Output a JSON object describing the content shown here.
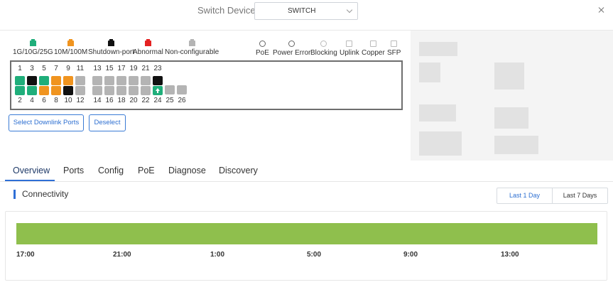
{
  "header": {
    "label": "Switch Device",
    "device_value": "SWITCH"
  },
  "legend": [
    {
      "label": "1G/10G/25G",
      "color": "#1fae7a"
    },
    {
      "label": "10M/100M",
      "color": "#f0941f"
    },
    {
      "label": "Shutdown-port",
      "color": "#111111"
    },
    {
      "label": "Abnormal",
      "color": "#e42222"
    },
    {
      "label": "Non-configurable",
      "color": "#b4b4b4"
    }
  ],
  "status_legend": [
    {
      "label": "PoE",
      "icon": "poe-icon"
    },
    {
      "label": "Power Error",
      "icon": "power-error-icon"
    },
    {
      "label": "Blocking",
      "icon": "blocking-icon"
    },
    {
      "label": "Uplink",
      "icon": "uplink-icon"
    },
    {
      "label": "Copper",
      "icon": "copper-icon"
    },
    {
      "label": "SFP",
      "icon": "sfp-icon"
    }
  ],
  "ports": {
    "top_numbers": [
      "1",
      "3",
      "5",
      "7",
      "9",
      "11",
      "13",
      "15",
      "17",
      "19",
      "21",
      "23"
    ],
    "bottom_numbers": [
      "2",
      "4",
      "6",
      "8",
      "10",
      "12",
      "14",
      "16",
      "18",
      "20",
      "22",
      "24",
      "25",
      "26"
    ],
    "top_status": [
      "green",
      "black",
      "green",
      "orange",
      "orange",
      "gray",
      "gray",
      "gray",
      "gray",
      "gray",
      "gray",
      "black"
    ],
    "bottom_status": [
      "green",
      "green",
      "orange",
      "orange",
      "black",
      "gray",
      "gray",
      "gray",
      "gray",
      "gray",
      "gray",
      "green-uplink",
      "gray",
      "gray"
    ]
  },
  "actions": {
    "select_downlink": "Select Downlink Ports",
    "deselect": "Deselect"
  },
  "tabs": [
    "Overview",
    "Ports",
    "Config",
    "PoE",
    "Diagnose",
    "Discovery"
  ],
  "active_tab": "Overview",
  "section": {
    "title": "Connectivity"
  },
  "range": {
    "options": [
      "Last 1 Day",
      "Last 7 Days"
    ],
    "selected": "Last 1 Day"
  },
  "timeline": {
    "ticks": [
      "17:00",
      "21:00",
      "1:00",
      "5:00",
      "9:00",
      "13:00"
    ],
    "status_color": "#8fbf4d"
  }
}
